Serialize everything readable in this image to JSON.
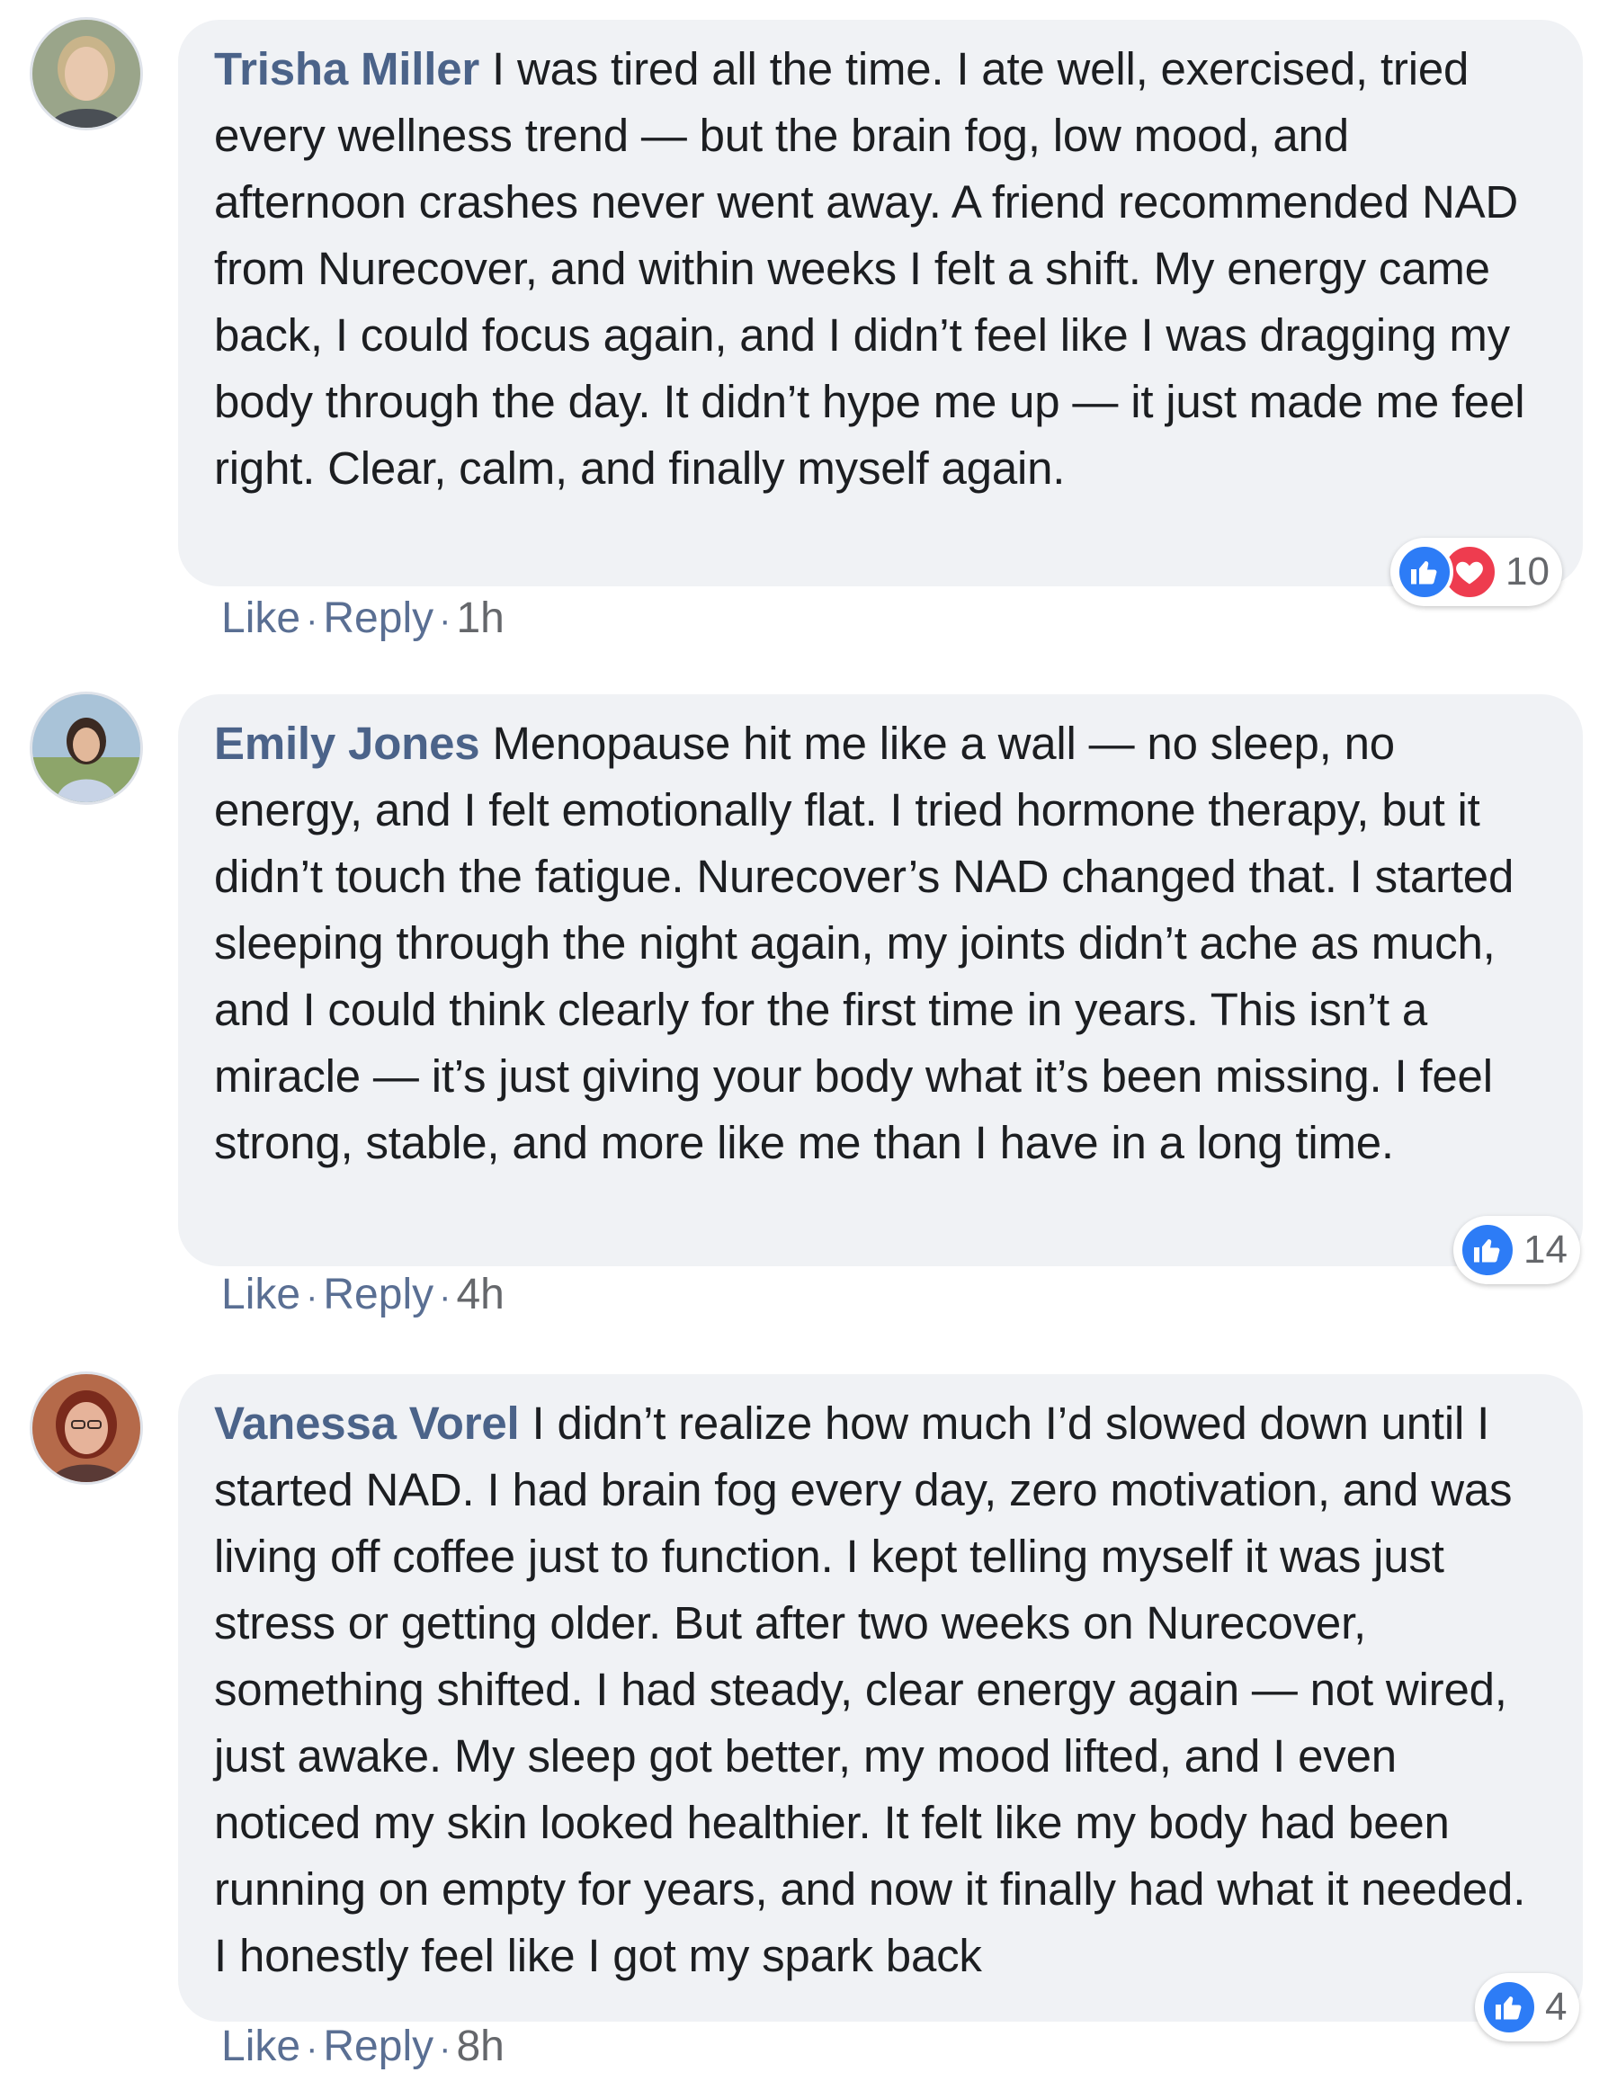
{
  "comments": [
    {
      "author": "Trisha Miller",
      "text": "I was tired all the time. I ate well, exercised, tried every wellness trend — but the brain fog, low mood, and afternoon crashes never went away. A friend recommended NAD from Nurecover, and within weeks I felt a shift. My energy came back, I could focus again, and I didn’t feel like I was dragging my body through the day. It didn’t hype me up — it just made me feel right. Clear, calm, and finally myself again.",
      "reaction_count": "10",
      "reactions": [
        "like-icon",
        "heart-icon"
      ],
      "like_label": "Like",
      "reply_label": "Reply",
      "time": "1h",
      "avatar_colors": {
        "bg": "#9aa58a",
        "hair": "#c9b48a",
        "skin": "#e8c8ae",
        "shirt": "#4a4f55"
      }
    },
    {
      "author": "Emily Jones",
      "text": "Menopause hit me like a wall — no sleep, no energy, and I felt emotionally flat. I tried hormone therapy, but it didn’t touch the fatigue. Nurecover’s NAD changed that. I started sleeping through the night again, my joints didn’t ache as much, and I could think clearly for the first time in years. This isn’t a miracle — it’s just giving your body what it’s been missing. I feel strong, stable, and more like me than I have in a long time.",
      "reaction_count": "14",
      "reactions": [
        "like-icon"
      ],
      "like_label": "Like",
      "reply_label": "Reply",
      "time": "4h",
      "avatar_colors": {
        "bg": "#a9c3d8",
        "hair": "#3b2a22",
        "skin": "#e2b89a",
        "shirt": "#c7d3e6"
      }
    },
    {
      "author": "Vanessa Vorel",
      "text": "I didn’t realize how much I’d slowed down until I started NAD. I had brain fog every day, zero motivation, and was living off coffee just to function. I kept telling myself it was just stress or getting older. But after two weeks on Nurecover, something shifted. I had steady, clear energy again — not wired, just awake. My sleep got better, my mood lifted, and I even noticed my skin looked healthier. It felt like my body had been running on empty for years, and now it finally had what it needed. I honestly feel like I got my spark back",
      "reaction_count": "4",
      "reactions": [
        "like-icon"
      ],
      "like_label": "Like",
      "reply_label": "Reply",
      "time": "8h",
      "avatar_colors": {
        "bg": "#b56a4a",
        "hair": "#7a2a1c",
        "skin": "#e6b39a",
        "shirt": "#5a3a36"
      }
    }
  ]
}
